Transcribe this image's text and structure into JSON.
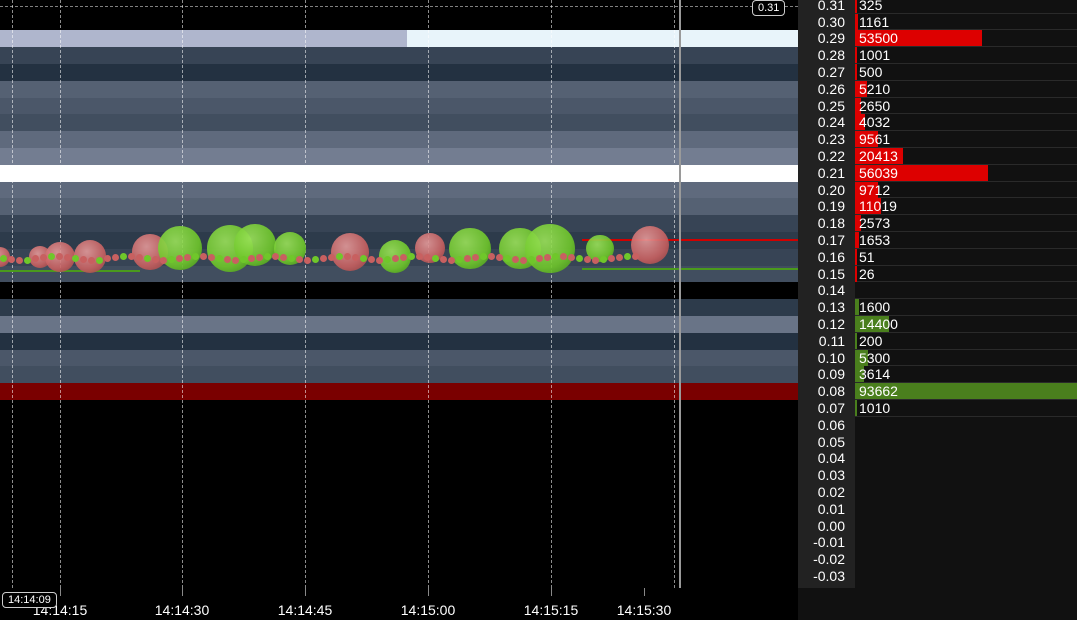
{
  "chart_data": {
    "type": "heatmap",
    "title": "",
    "xlabel": "",
    "ylabel": "",
    "price_ticks": [
      "0.31",
      "0.30",
      "0.29",
      "0.28",
      "0.27",
      "0.26",
      "0.25",
      "0.24",
      "0.23",
      "0.22",
      "0.21",
      "0.20",
      "0.19",
      "0.18",
      "0.17",
      "0.16",
      "0.15",
      "0.14",
      "0.13",
      "0.12",
      "0.11",
      "0.10",
      "0.09",
      "0.08",
      "0.07",
      "0.06",
      "0.05",
      "0.04",
      "0.03",
      "0.02",
      "0.01",
      "0.00",
      "-0.01",
      "-0.02",
      "-0.03"
    ],
    "time_ticks": [
      "14:14:15",
      "14:14:30",
      "14:14:45",
      "14:15:00",
      "14:15:15",
      "14:15:30"
    ],
    "order_book": [
      {
        "price": 0.31,
        "qty": "325",
        "side": "ask"
      },
      {
        "price": 0.3,
        "qty": "1161",
        "side": "ask"
      },
      {
        "price": 0.29,
        "qty": "53500",
        "side": "ask"
      },
      {
        "price": 0.28,
        "qty": "1001",
        "side": "ask"
      },
      {
        "price": 0.27,
        "qty": "500",
        "side": "ask"
      },
      {
        "price": 0.26,
        "qty": "5210",
        "side": "ask"
      },
      {
        "price": 0.25,
        "qty": "2650",
        "side": "ask"
      },
      {
        "price": 0.24,
        "qty": "4032",
        "side": "ask"
      },
      {
        "price": 0.23,
        "qty": "9561",
        "side": "ask"
      },
      {
        "price": 0.22,
        "qty": "20413",
        "side": "ask"
      },
      {
        "price": 0.21,
        "qty": "56039",
        "side": "ask"
      },
      {
        "price": 0.2,
        "qty": "9712",
        "side": "ask"
      },
      {
        "price": 0.19,
        "qty": "11019",
        "side": "ask"
      },
      {
        "price": 0.18,
        "qty": "2573",
        "side": "ask"
      },
      {
        "price": 0.17,
        "qty": "1653",
        "side": "ask"
      },
      {
        "price": 0.16,
        "qty": "51",
        "side": "ask"
      },
      {
        "price": 0.15,
        "qty": "26",
        "side": "ask"
      },
      {
        "price": 0.14,
        "qty": "",
        "side": "none"
      },
      {
        "price": 0.13,
        "qty": "1600",
        "side": "bid"
      },
      {
        "price": 0.12,
        "qty": "14400",
        "side": "bid"
      },
      {
        "price": 0.11,
        "qty": "200",
        "side": "bid"
      },
      {
        "price": 0.1,
        "qty": "5300",
        "side": "bid"
      },
      {
        "price": 0.09,
        "qty": "3614",
        "side": "bid"
      },
      {
        "price": 0.08,
        "qty": "93662",
        "side": "bid"
      },
      {
        "price": 0.07,
        "qty": "1010",
        "side": "bid"
      }
    ],
    "heat_bands": [
      {
        "price": 0.29,
        "intensity": 0.8
      },
      {
        "price": 0.28,
        "intensity": 0.2
      },
      {
        "price": 0.27,
        "intensity": 0.1
      },
      {
        "price": 0.26,
        "intensity": 0.35
      },
      {
        "price": 0.25,
        "intensity": 0.3
      },
      {
        "price": 0.24,
        "intensity": 0.25
      },
      {
        "price": 0.23,
        "intensity": 0.4
      },
      {
        "price": 0.22,
        "intensity": 0.5
      },
      {
        "price": 0.21,
        "intensity": 1.0
      },
      {
        "price": 0.2,
        "intensity": 0.4
      },
      {
        "price": 0.19,
        "intensity": 0.35
      },
      {
        "price": 0.18,
        "intensity": 0.2
      },
      {
        "price": 0.17,
        "intensity": 0.15
      },
      {
        "price": 0.16,
        "intensity": 0.2
      },
      {
        "price": 0.15,
        "intensity": 0.25
      },
      {
        "price": 0.13,
        "intensity": 0.15
      },
      {
        "price": 0.12,
        "intensity": 0.45
      },
      {
        "price": 0.11,
        "intensity": 0.1
      },
      {
        "price": 0.1,
        "intensity": 0.3
      },
      {
        "price": 0.09,
        "intensity": 0.25
      },
      {
        "price": 0.08,
        "intensity": 0.6,
        "color": "#7a0000"
      }
    ],
    "trades": [
      {
        "t": 0.0,
        "price": 0.16,
        "size": 0.15,
        "side": "sell"
      },
      {
        "t": 0.08,
        "price": 0.16,
        "size": 0.2,
        "side": "sell"
      },
      {
        "t": 0.12,
        "price": 0.16,
        "size": 0.5,
        "side": "sell"
      },
      {
        "t": 0.18,
        "price": 0.16,
        "size": 0.6,
        "side": "sell"
      },
      {
        "t": 0.3,
        "price": 0.163,
        "size": 0.7,
        "side": "sell"
      },
      {
        "t": 0.36,
        "price": 0.165,
        "size": 1.0,
        "side": "buy"
      },
      {
        "t": 0.46,
        "price": 0.165,
        "size": 1.1,
        "side": "buy"
      },
      {
        "t": 0.51,
        "price": 0.167,
        "size": 0.9,
        "side": "buy"
      },
      {
        "t": 0.58,
        "price": 0.165,
        "size": 0.6,
        "side": "buy"
      },
      {
        "t": 0.7,
        "price": 0.163,
        "size": 0.8,
        "side": "sell"
      },
      {
        "t": 0.79,
        "price": 0.16,
        "size": 0.6,
        "side": "buy"
      },
      {
        "t": 0.86,
        "price": 0.165,
        "size": 0.5,
        "side": "sell"
      },
      {
        "t": 0.94,
        "price": 0.165,
        "size": 0.9,
        "side": "buy"
      },
      {
        "t": 1.04,
        "price": 0.165,
        "size": 0.9,
        "side": "buy"
      },
      {
        "t": 1.1,
        "price": 0.165,
        "size": 1.2,
        "side": "buy"
      },
      {
        "t": 1.2,
        "price": 0.165,
        "size": 0.4,
        "side": "buy"
      },
      {
        "t": 1.3,
        "price": 0.167,
        "size": 0.8,
        "side": "sell"
      }
    ],
    "last_price_tag": "0.31",
    "time_tag": "14:14:09",
    "colors": {
      "ask_bar": "#dd0000",
      "bid_bar": "#4a7f1d",
      "buy_trade": "#6fc72a",
      "sell_trade": "#c86060"
    }
  }
}
